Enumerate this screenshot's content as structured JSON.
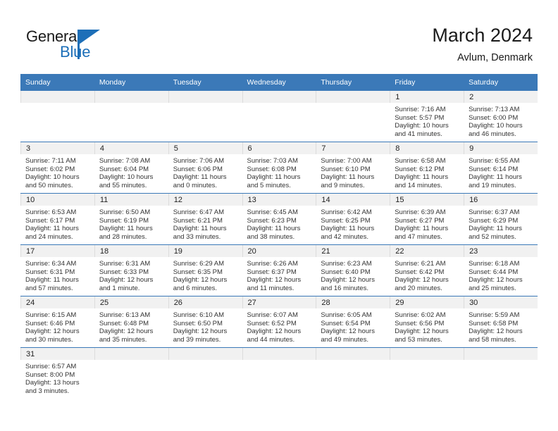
{
  "brand": {
    "name_top": "General",
    "name_bottom": "Blue"
  },
  "header": {
    "title": "March 2024",
    "location": "Avlum, Denmark"
  },
  "colors": {
    "header_blue": "#3b79b8",
    "brand_blue": "#1d6fb8",
    "daynum_band": "#f1f1f1"
  },
  "weekday_headers": [
    "Sunday",
    "Monday",
    "Tuesday",
    "Wednesday",
    "Thursday",
    "Friday",
    "Saturday"
  ],
  "labels": {
    "sunrise_prefix": "Sunrise:",
    "sunset_prefix": "Sunset:",
    "daylight_prefix": "Daylight:"
  },
  "weeks": [
    [
      {
        "day": "",
        "empty": true
      },
      {
        "day": "",
        "empty": true
      },
      {
        "day": "",
        "empty": true
      },
      {
        "day": "",
        "empty": true
      },
      {
        "day": "",
        "empty": true
      },
      {
        "day": "1",
        "sunrise": "Sunrise: 7:16 AM",
        "sunset": "Sunset: 5:57 PM",
        "daylight1": "Daylight: 10 hours",
        "daylight2": "and 41 minutes."
      },
      {
        "day": "2",
        "sunrise": "Sunrise: 7:13 AM",
        "sunset": "Sunset: 6:00 PM",
        "daylight1": "Daylight: 10 hours",
        "daylight2": "and 46 minutes."
      }
    ],
    [
      {
        "day": "3",
        "sunrise": "Sunrise: 7:11 AM",
        "sunset": "Sunset: 6:02 PM",
        "daylight1": "Daylight: 10 hours",
        "daylight2": "and 50 minutes."
      },
      {
        "day": "4",
        "sunrise": "Sunrise: 7:08 AM",
        "sunset": "Sunset: 6:04 PM",
        "daylight1": "Daylight: 10 hours",
        "daylight2": "and 55 minutes."
      },
      {
        "day": "5",
        "sunrise": "Sunrise: 7:06 AM",
        "sunset": "Sunset: 6:06 PM",
        "daylight1": "Daylight: 11 hours",
        "daylight2": "and 0 minutes."
      },
      {
        "day": "6",
        "sunrise": "Sunrise: 7:03 AM",
        "sunset": "Sunset: 6:08 PM",
        "daylight1": "Daylight: 11 hours",
        "daylight2": "and 5 minutes."
      },
      {
        "day": "7",
        "sunrise": "Sunrise: 7:00 AM",
        "sunset": "Sunset: 6:10 PM",
        "daylight1": "Daylight: 11 hours",
        "daylight2": "and 9 minutes."
      },
      {
        "day": "8",
        "sunrise": "Sunrise: 6:58 AM",
        "sunset": "Sunset: 6:12 PM",
        "daylight1": "Daylight: 11 hours",
        "daylight2": "and 14 minutes."
      },
      {
        "day": "9",
        "sunrise": "Sunrise: 6:55 AM",
        "sunset": "Sunset: 6:14 PM",
        "daylight1": "Daylight: 11 hours",
        "daylight2": "and 19 minutes."
      }
    ],
    [
      {
        "day": "10",
        "sunrise": "Sunrise: 6:53 AM",
        "sunset": "Sunset: 6:17 PM",
        "daylight1": "Daylight: 11 hours",
        "daylight2": "and 24 minutes."
      },
      {
        "day": "11",
        "sunrise": "Sunrise: 6:50 AM",
        "sunset": "Sunset: 6:19 PM",
        "daylight1": "Daylight: 11 hours",
        "daylight2": "and 28 minutes."
      },
      {
        "day": "12",
        "sunrise": "Sunrise: 6:47 AM",
        "sunset": "Sunset: 6:21 PM",
        "daylight1": "Daylight: 11 hours",
        "daylight2": "and 33 minutes."
      },
      {
        "day": "13",
        "sunrise": "Sunrise: 6:45 AM",
        "sunset": "Sunset: 6:23 PM",
        "daylight1": "Daylight: 11 hours",
        "daylight2": "and 38 minutes."
      },
      {
        "day": "14",
        "sunrise": "Sunrise: 6:42 AM",
        "sunset": "Sunset: 6:25 PM",
        "daylight1": "Daylight: 11 hours",
        "daylight2": "and 42 minutes."
      },
      {
        "day": "15",
        "sunrise": "Sunrise: 6:39 AM",
        "sunset": "Sunset: 6:27 PM",
        "daylight1": "Daylight: 11 hours",
        "daylight2": "and 47 minutes."
      },
      {
        "day": "16",
        "sunrise": "Sunrise: 6:37 AM",
        "sunset": "Sunset: 6:29 PM",
        "daylight1": "Daylight: 11 hours",
        "daylight2": "and 52 minutes."
      }
    ],
    [
      {
        "day": "17",
        "sunrise": "Sunrise: 6:34 AM",
        "sunset": "Sunset: 6:31 PM",
        "daylight1": "Daylight: 11 hours",
        "daylight2": "and 57 minutes."
      },
      {
        "day": "18",
        "sunrise": "Sunrise: 6:31 AM",
        "sunset": "Sunset: 6:33 PM",
        "daylight1": "Daylight: 12 hours",
        "daylight2": "and 1 minute."
      },
      {
        "day": "19",
        "sunrise": "Sunrise: 6:29 AM",
        "sunset": "Sunset: 6:35 PM",
        "daylight1": "Daylight: 12 hours",
        "daylight2": "and 6 minutes."
      },
      {
        "day": "20",
        "sunrise": "Sunrise: 6:26 AM",
        "sunset": "Sunset: 6:37 PM",
        "daylight1": "Daylight: 12 hours",
        "daylight2": "and 11 minutes."
      },
      {
        "day": "21",
        "sunrise": "Sunrise: 6:23 AM",
        "sunset": "Sunset: 6:40 PM",
        "daylight1": "Daylight: 12 hours",
        "daylight2": "and 16 minutes."
      },
      {
        "day": "22",
        "sunrise": "Sunrise: 6:21 AM",
        "sunset": "Sunset: 6:42 PM",
        "daylight1": "Daylight: 12 hours",
        "daylight2": "and 20 minutes."
      },
      {
        "day": "23",
        "sunrise": "Sunrise: 6:18 AM",
        "sunset": "Sunset: 6:44 PM",
        "daylight1": "Daylight: 12 hours",
        "daylight2": "and 25 minutes."
      }
    ],
    [
      {
        "day": "24",
        "sunrise": "Sunrise: 6:15 AM",
        "sunset": "Sunset: 6:46 PM",
        "daylight1": "Daylight: 12 hours",
        "daylight2": "and 30 minutes."
      },
      {
        "day": "25",
        "sunrise": "Sunrise: 6:13 AM",
        "sunset": "Sunset: 6:48 PM",
        "daylight1": "Daylight: 12 hours",
        "daylight2": "and 35 minutes."
      },
      {
        "day": "26",
        "sunrise": "Sunrise: 6:10 AM",
        "sunset": "Sunset: 6:50 PM",
        "daylight1": "Daylight: 12 hours",
        "daylight2": "and 39 minutes."
      },
      {
        "day": "27",
        "sunrise": "Sunrise: 6:07 AM",
        "sunset": "Sunset: 6:52 PM",
        "daylight1": "Daylight: 12 hours",
        "daylight2": "and 44 minutes."
      },
      {
        "day": "28",
        "sunrise": "Sunrise: 6:05 AM",
        "sunset": "Sunset: 6:54 PM",
        "daylight1": "Daylight: 12 hours",
        "daylight2": "and 49 minutes."
      },
      {
        "day": "29",
        "sunrise": "Sunrise: 6:02 AM",
        "sunset": "Sunset: 6:56 PM",
        "daylight1": "Daylight: 12 hours",
        "daylight2": "and 53 minutes."
      },
      {
        "day": "30",
        "sunrise": "Sunrise: 5:59 AM",
        "sunset": "Sunset: 6:58 PM",
        "daylight1": "Daylight: 12 hours",
        "daylight2": "and 58 minutes."
      }
    ],
    [
      {
        "day": "31",
        "sunrise": "Sunrise: 6:57 AM",
        "sunset": "Sunset: 8:00 PM",
        "daylight1": "Daylight: 13 hours",
        "daylight2": "and 3 minutes."
      },
      {
        "day": "",
        "empty": true
      },
      {
        "day": "",
        "empty": true
      },
      {
        "day": "",
        "empty": true
      },
      {
        "day": "",
        "empty": true
      },
      {
        "day": "",
        "empty": true
      },
      {
        "day": "",
        "empty": true
      }
    ]
  ]
}
